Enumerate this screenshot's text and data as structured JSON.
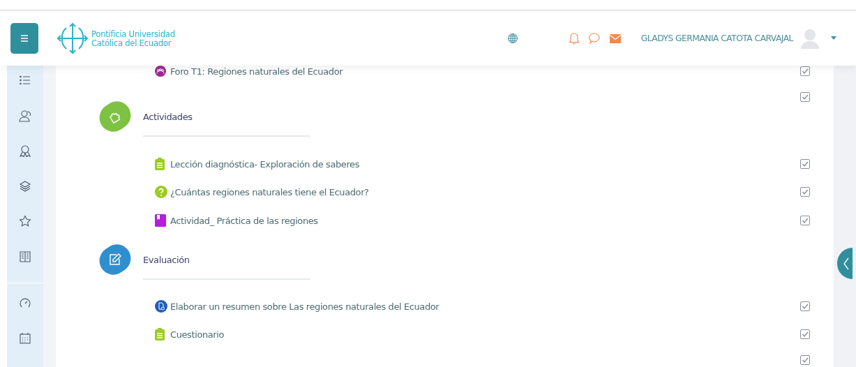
{
  "header": {
    "logo_text": [
      "Pontificia Universidad",
      "Católica del Ecuador"
    ],
    "user_name": "GLADYS GERMANIA CATOTA CARVAJAL"
  },
  "sidebar": {
    "items": [
      {
        "kind": "list"
      },
      {
        "kind": "users"
      },
      {
        "kind": "award"
      },
      {
        "kind": "layers"
      },
      {
        "kind": "star"
      },
      {
        "kind": "book"
      },
      {
        "kind": "divider"
      },
      {
        "kind": "gauge"
      },
      {
        "kind": "calendar"
      }
    ]
  },
  "blocks": [
    {
      "kind": "items",
      "items": [
        {
          "kind": "forum",
          "title": "Foro T1: Regiones naturales del Ecuador",
          "checked": true
        },
        {
          "kind": "unlabeled",
          "checked": true
        }
      ]
    },
    {
      "kind": "activities",
      "title": "Actividades",
      "color": "#7dc242",
      "items": [
        {
          "kind": "clipboard",
          "title": "Lección diagnóstica- Exploración de saberes",
          "checked": true
        },
        {
          "kind": "question",
          "title": "¿Cuántas regiones naturales tiene el Ecuador?",
          "checked": true
        },
        {
          "kind": "book",
          "title": "Actividad_ Práctica de las regiones",
          "checked": true
        }
      ]
    },
    {
      "kind": "assessment",
      "title": "Evaluación",
      "color": "#2f8fce",
      "items": [
        {
          "kind": "assignment",
          "title": "Elaborar un resumen sobre Las regiones naturales del Ecuador",
          "checked": true
        },
        {
          "kind": "clipboard",
          "title": "Cuestionario",
          "checked": true
        },
        {
          "kind": "unlabeled",
          "checked": true
        }
      ]
    }
  ]
}
